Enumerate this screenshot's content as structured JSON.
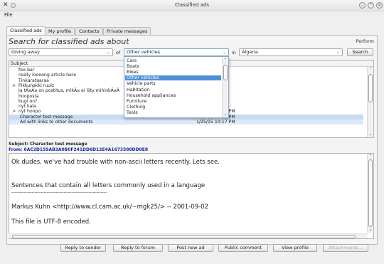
{
  "window": {
    "title": "Classified ads",
    "menu_file": "File"
  },
  "tabs": [
    "Classified ads",
    "My profile",
    "Contacts",
    "Private messages"
  ],
  "search": {
    "heading": "Search for classified ads about",
    "perform_label": "Perform",
    "type_value": "Giving away",
    "of_label": "of",
    "category_value": "Other vehicles",
    "in_label": "in",
    "country_value": "Algeria",
    "search_button": "Search"
  },
  "category_options": [
    "Cars",
    "Boats",
    "Bikes",
    "Other vehicles",
    "Vehicle parts",
    "Habitation",
    "Household appliances",
    "Furniture",
    "Clothing",
    "Tools"
  ],
  "category_selected_index": 3,
  "list": {
    "header": "Subject",
    "rows": [
      {
        "subject": "foo-bar",
        "date": "",
        "indent": 1,
        "expander": ""
      },
      {
        "subject": "really loooong article here",
        "date": "",
        "indent": 1,
        "expander": ""
      },
      {
        "subject": "Tinkarataaraa",
        "date": "",
        "indent": 1,
        "expander": ""
      },
      {
        "subject": "Pikkunakki ruulz",
        "date": "",
        "indent": 1,
        "expander": ">"
      },
      {
        "subject": "Ja tÃ¤Ã¤ on postitus, mikÃ¤ ei liity mihinkÃ¤Ã",
        "date": "",
        "indent": 1,
        "expander": ""
      },
      {
        "subject": "hooposta",
        "date": "",
        "indent": 1,
        "expander": ""
      },
      {
        "subject": "bugi on?",
        "date": "",
        "indent": 1,
        "expander": ""
      },
      {
        "subject": "nyt kala",
        "date": "",
        "indent": 1,
        "expander": ""
      },
      {
        "subject": "nyt hoopo",
        "date": "8/24/14 10:54 PM",
        "indent": 1,
        "expander": ">"
      },
      {
        "subject": "Character test message",
        "date": "12/25/14 3:35 PM",
        "indent": 2,
        "expander": ""
      },
      {
        "subject": "Ad with links to other documents",
        "date": "1/25/15 10:17 PM",
        "indent": 2,
        "expander": ""
      }
    ],
    "selected_index": 9
  },
  "message": {
    "subject_line": "Subject: Character test message",
    "from_line": "From: 6AC2D159AB3A0B0F241DD6D12E4A1673588DD0E8",
    "body": [
      "Ok dudes, we've had trouble with non-ascii letters recently. Lets see.",
      "Sentences that contain all letters commonly used in a language",
      "--------------------------------------------------------------",
      "Markus Kuhn <http://www.cl.cam.ac.uk/~mgk25/> -- 2001-09-02",
      "This file is UTF-8 encoded."
    ]
  },
  "actions": {
    "reply_sender": "Reply to sender",
    "reply_forum": "Reply to forum",
    "post_new_ad": "Post new ad",
    "public_comment": "Public comment",
    "view_profile": "View profile",
    "attachments": "Attachments..."
  },
  "colors": {
    "selection": "#4d90d7",
    "row_selection": "#c4dbf2",
    "from_color": "#1a2aa8"
  }
}
